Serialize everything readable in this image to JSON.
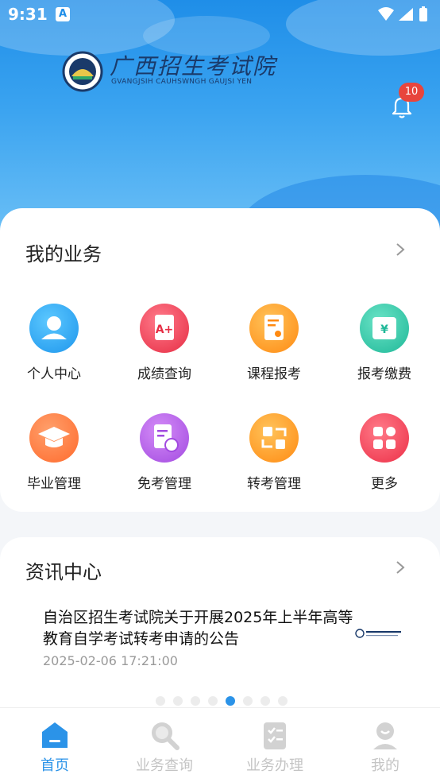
{
  "status_bar": {
    "time": "9:31",
    "input_badge": "A"
  },
  "brand": {
    "title": "广西招生考试院",
    "subtitle": "GVANGJSIH CAUHSWNGH GAUJSI YEN"
  },
  "notifications": {
    "count": "10"
  },
  "my_business": {
    "title": "我的业务",
    "items": [
      {
        "label": "个人中心",
        "icon": "user-icon",
        "color": "#2aa7ef"
      },
      {
        "label": "成绩查询",
        "icon": "grade-icon",
        "color": "#ef4154"
      },
      {
        "label": "课程报考",
        "icon": "course-icon",
        "color": "#ff9a1f"
      },
      {
        "label": "报考缴费",
        "icon": "payment-icon",
        "color": "#2fc7a8"
      },
      {
        "label": "毕业管理",
        "icon": "graduation-cap-icon",
        "color": "#ff7a3d"
      },
      {
        "label": "免考管理",
        "icon": "exemption-icon",
        "color": "#b45ee8"
      },
      {
        "label": "转考管理",
        "icon": "transfer-icon",
        "color": "#ff9a1f"
      },
      {
        "label": "更多",
        "icon": "more-grid-icon",
        "color": "#f04658"
      }
    ]
  },
  "news": {
    "title": "资讯中心",
    "items": [
      {
        "title": "自治区招生考试院关于开展2025年上半年高等教育自学考试转考申请的公告",
        "time": "2025-02-06 17:21:00"
      }
    ],
    "carousel": {
      "pages": 8,
      "active_page": 5
    }
  },
  "tabs": [
    {
      "label": "首页",
      "icon": "home-icon",
      "active": true
    },
    {
      "label": "业务查询",
      "icon": "search-icon",
      "active": false
    },
    {
      "label": "业务办理",
      "icon": "clipboard-icon",
      "active": false
    },
    {
      "label": "我的",
      "icon": "profile-icon",
      "active": false
    }
  ]
}
